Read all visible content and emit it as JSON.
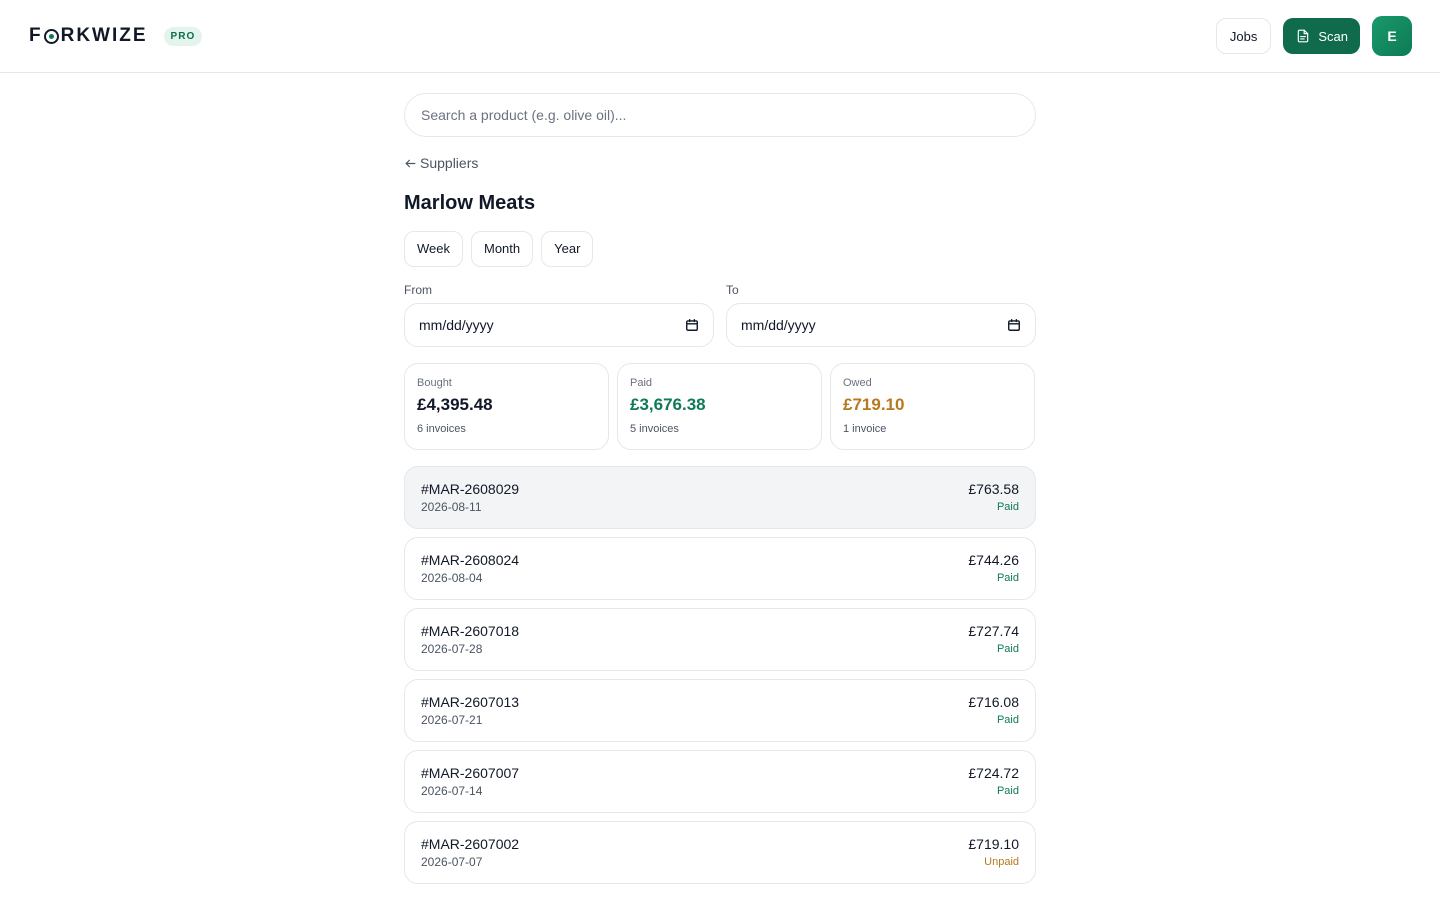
{
  "header": {
    "brand_prefix": "F",
    "brand_suffix": "RKWIZE",
    "badge": "PRO",
    "jobs_label": "Jobs",
    "scan_label": "Scan",
    "avatar_initial": "E"
  },
  "search": {
    "placeholder": "Search a product (e.g. olive oil)..."
  },
  "back_link": "Suppliers",
  "supplier_name": "Marlow Meats",
  "ranges": [
    "Week",
    "Month",
    "Year"
  ],
  "dates": {
    "from_label": "From",
    "from_value": "mm/dd/yyyy",
    "to_label": "To",
    "to_value": "mm/dd/yyyy"
  },
  "stats": [
    {
      "label": "Bought",
      "value": "£4,395.48",
      "sub": "6 invoices",
      "color": "#111827"
    },
    {
      "label": "Paid",
      "value": "£3,676.38",
      "sub": "5 invoices",
      "color": "#0f7a55"
    },
    {
      "label": "Owed",
      "value": "£719.10",
      "sub": "1 invoice",
      "color": "#b7791f"
    }
  ],
  "invoices": [
    {
      "id": "#MAR-2608029",
      "date": "2026-08-11",
      "amount": "£763.58",
      "status": "Paid",
      "selected": true
    },
    {
      "id": "#MAR-2608024",
      "date": "2026-08-04",
      "amount": "£744.26",
      "status": "Paid"
    },
    {
      "id": "#MAR-2607018",
      "date": "2026-07-28",
      "amount": "£727.74",
      "status": "Paid"
    },
    {
      "id": "#MAR-2607013",
      "date": "2026-07-21",
      "amount": "£716.08",
      "status": "Paid"
    },
    {
      "id": "#MAR-2607007",
      "date": "2026-07-14",
      "amount": "£724.72",
      "status": "Paid"
    },
    {
      "id": "#MAR-2607002",
      "date": "2026-07-07",
      "amount": "£719.10",
      "status": "Unpaid"
    }
  ],
  "colors": {
    "accent": "#0f6b4c",
    "paid": "#0f7a55",
    "unpaid": "#b7791f"
  },
  "icons": {
    "back": "arrow-left-icon",
    "scan": "document-icon",
    "calendar": "calendar-icon"
  }
}
